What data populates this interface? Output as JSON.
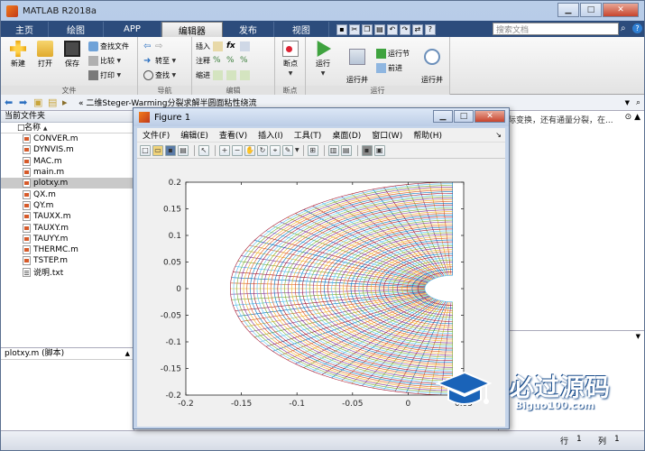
{
  "window": {
    "title": "MATLAB R2018a"
  },
  "tabs": [
    {
      "label": "主页"
    },
    {
      "label": "绘图"
    },
    {
      "label": "APP"
    },
    {
      "label": "编辑器"
    },
    {
      "label": "发布"
    },
    {
      "label": "视图"
    }
  ],
  "search": {
    "placeholder": "搜索文档"
  },
  "ribbon": {
    "file_group": {
      "label": "文件",
      "new": "新建",
      "open": "打开",
      "save": "保存",
      "find_files": "查找文件",
      "compare": "比较",
      "print": "打印"
    },
    "nav_group": {
      "label": "导航",
      "goto": "转至",
      "find": "查找"
    },
    "edit_group": {
      "label": "编辑",
      "insert": "插入",
      "comment": "注释",
      "indent": "缩进"
    },
    "breakpoint_group": {
      "label": "断点",
      "breakpoints": "断点"
    },
    "run_group": {
      "label": "运行",
      "run": "运行",
      "run_advance": "运行并\n前进",
      "run_section": "运行节",
      "advance": "前进",
      "run_time": "运行并\n计时"
    }
  },
  "address": {
    "path": "« 二维Steger-Warming分裂求解半圆面粘性绕流"
  },
  "current_folder": {
    "title": "当前文件夹",
    "column": "名称",
    "files": [
      {
        "name": "CONVER.m",
        "type": "m"
      },
      {
        "name": "DYNVIS.m",
        "type": "m"
      },
      {
        "name": "MAC.m",
        "type": "m"
      },
      {
        "name": "main.m",
        "type": "m"
      },
      {
        "name": "plotxy.m",
        "type": "m",
        "selected": true
      },
      {
        "name": "QX.m",
        "type": "m"
      },
      {
        "name": "QY.m",
        "type": "m"
      },
      {
        "name": "TAUXX.m",
        "type": "m"
      },
      {
        "name": "TAUXY.m",
        "type": "m"
      },
      {
        "name": "TAUYY.m",
        "type": "m"
      },
      {
        "name": "THERMC.m",
        "type": "m"
      },
      {
        "name": "TSTEP.m",
        "type": "m"
      },
      {
        "name": "说明.txt",
        "type": "txt"
      }
    ]
  },
  "details": {
    "title": "plotxy.m (脚本)"
  },
  "command": {
    "text": "际变换，还有通量分裂，在..."
  },
  "status": {
    "row_label": "行",
    "row": "1",
    "col_label": "列",
    "col": "1"
  },
  "figure": {
    "title": "Figure 1",
    "menu": [
      "文件(F)",
      "编辑(E)",
      "查看(V)",
      "插入(I)",
      "工具(T)",
      "桌面(D)",
      "窗口(W)",
      "帮助(H)"
    ]
  },
  "chart_data": {
    "type": "line",
    "title": "",
    "xlabel": "",
    "ylabel": "",
    "xlim": [
      -0.2,
      0.05
    ],
    "ylim": [
      -0.2,
      0.2
    ],
    "xticks": [
      -0.2,
      -0.15,
      -0.1,
      -0.05,
      0,
      0.05
    ],
    "yticks": [
      -0.2,
      -0.15,
      -0.1,
      -0.05,
      0,
      0.05,
      0.1,
      0.15,
      0.2
    ],
    "xtick_labels": [
      "-0.2",
      "-0.15",
      "-0.1",
      "-0.05",
      "0",
      "0.05"
    ],
    "ytick_labels": [
      "-0.2",
      "-0.15",
      "-0.1",
      "-0.05",
      "0",
      "0.05",
      "0.1",
      "0.15",
      "0.2"
    ],
    "mesh": {
      "description_shape": "half-ellipse body-fitted grid",
      "inner_radius": 0.025,
      "outer_semi_x": 0.2,
      "outer_semi_y": 0.2,
      "center_x": 0.04,
      "center_y": 0,
      "radial_lines": 60,
      "circumferential_lines": 50
    },
    "grid": false
  },
  "watermark": {
    "big": "必过源码",
    "small": "Biguo100.com"
  },
  "colors": {
    "matlab_blue": "#0072BD",
    "matlab_orange": "#D95319",
    "matlab_yellow": "#EDB120",
    "matlab_purple": "#7E2F8E",
    "matlab_green": "#77AC30",
    "matlab_cyan": "#4DBEEE",
    "matlab_red": "#A2142F"
  }
}
